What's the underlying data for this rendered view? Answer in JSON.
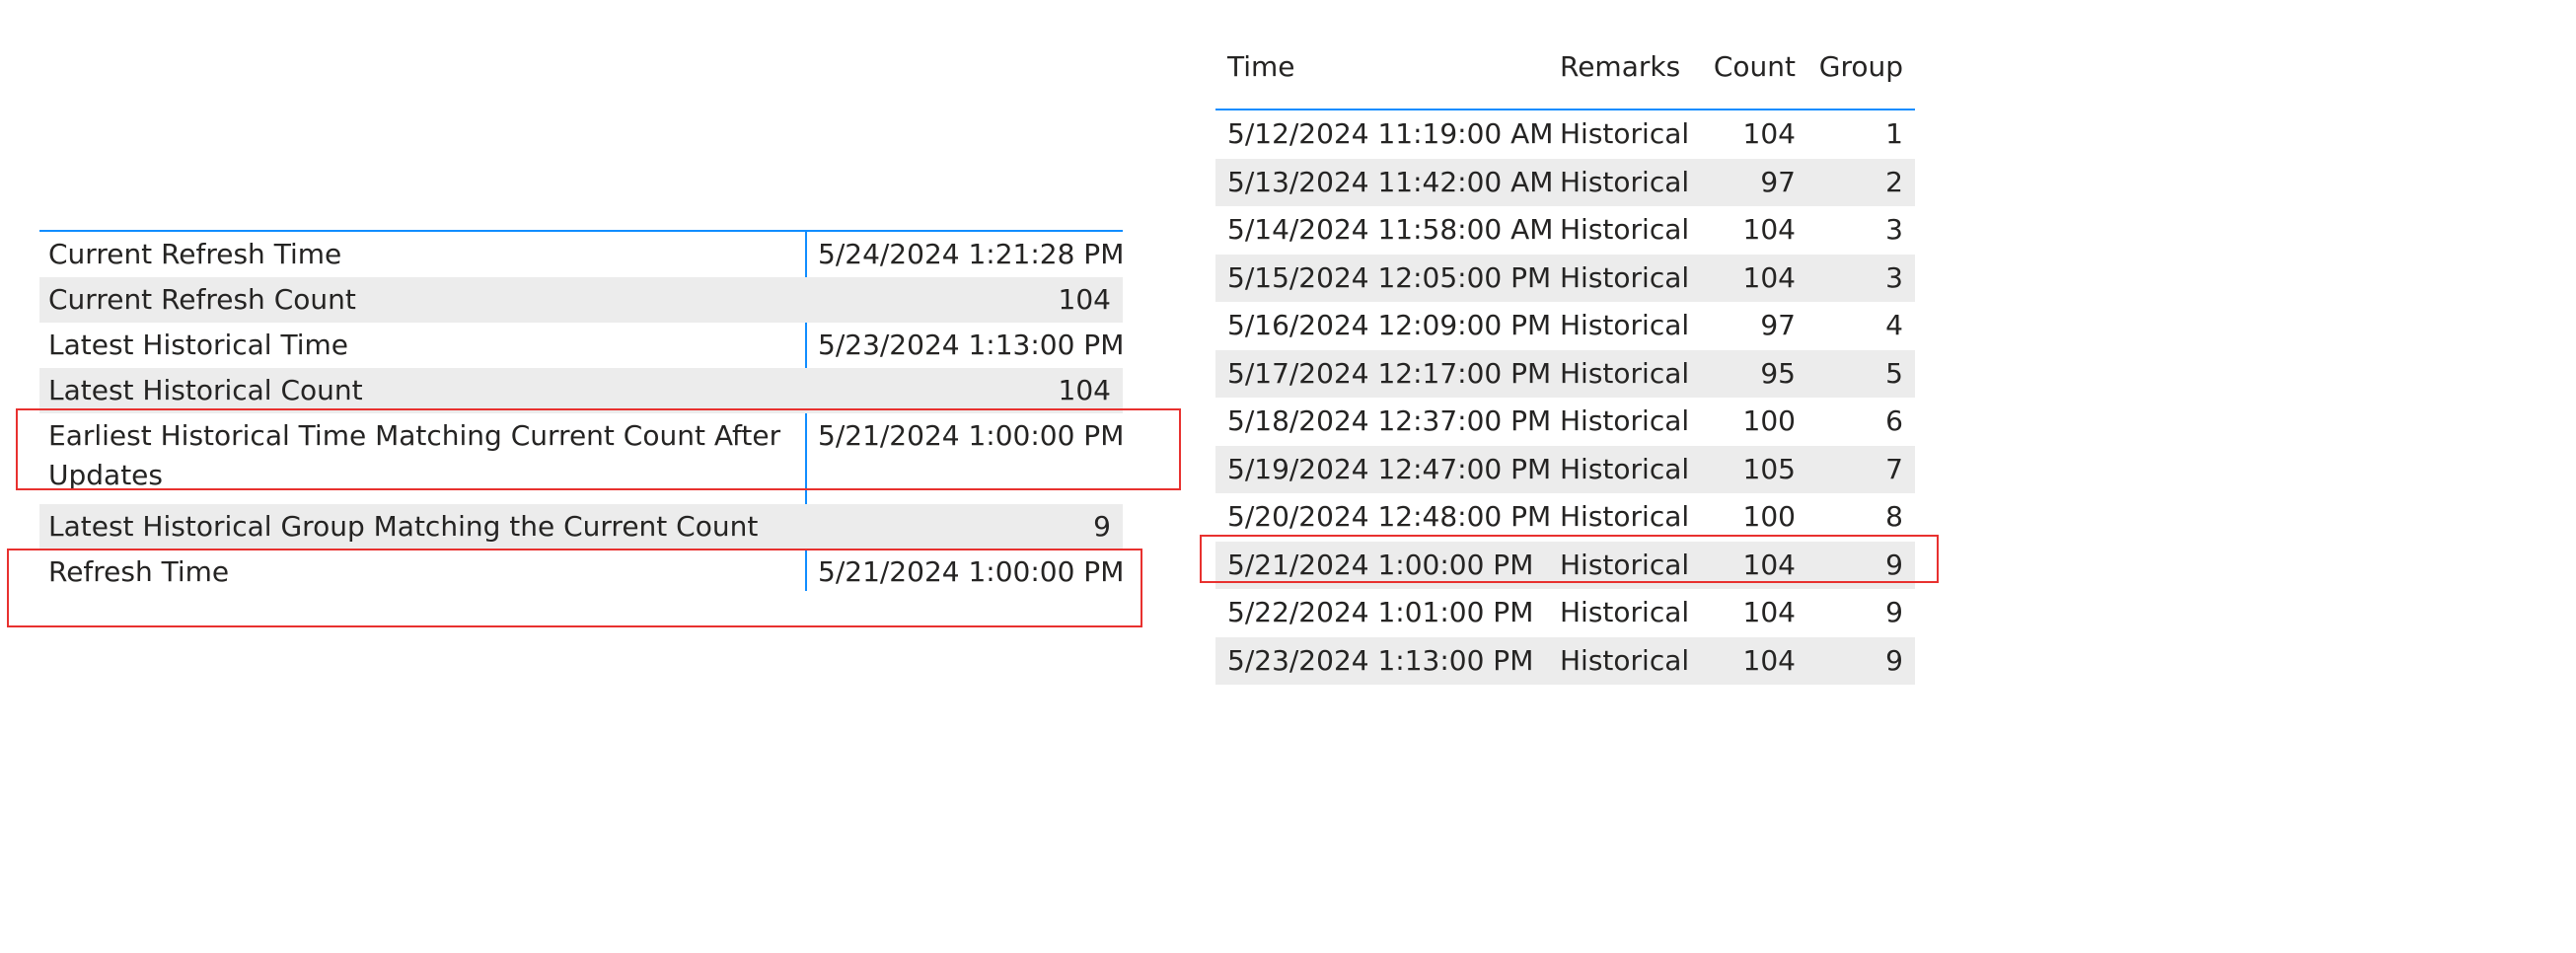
{
  "summary_table": {
    "rows": [
      {
        "label": "Current Refresh Time",
        "value": "5/24/2024 1:21:28 PM"
      },
      {
        "label": "Current Refresh Count",
        "value": "104"
      },
      {
        "label": "Latest Historical Time",
        "value": "5/23/2024 1:13:00 PM"
      },
      {
        "label": "Latest Historical Count",
        "value": "104"
      },
      {
        "label": "Earliest Historical Time Matching Current Count After Updates",
        "value": "5/21/2024 1:00:00 PM"
      },
      {
        "label": "Latest Historical Group Matching the Current Count",
        "value": "9"
      },
      {
        "label": "Refresh Time",
        "value": "5/21/2024 1:00:00 PM"
      }
    ]
  },
  "history_table": {
    "headers": {
      "time": "Time",
      "remarks": "Remarks",
      "count": "Count",
      "group": "Group"
    },
    "rows": [
      {
        "time": "5/12/2024 11:19:00 AM",
        "remarks": "Historical",
        "count": "104",
        "group": "1"
      },
      {
        "time": "5/13/2024 11:42:00 AM",
        "remarks": "Historical",
        "count": "97",
        "group": "2"
      },
      {
        "time": "5/14/2024 11:58:00 AM",
        "remarks": "Historical",
        "count": "104",
        "group": "3"
      },
      {
        "time": "5/15/2024 12:05:00 PM",
        "remarks": "Historical",
        "count": "104",
        "group": "3"
      },
      {
        "time": "5/16/2024 12:09:00 PM",
        "remarks": "Historical",
        "count": "97",
        "group": "4"
      },
      {
        "time": "5/17/2024 12:17:00 PM",
        "remarks": "Historical",
        "count": "95",
        "group": "5"
      },
      {
        "time": "5/18/2024 12:37:00 PM",
        "remarks": "Historical",
        "count": "100",
        "group": "6"
      },
      {
        "time": "5/19/2024 12:47:00 PM",
        "remarks": "Historical",
        "count": "105",
        "group": "7"
      },
      {
        "time": "5/20/2024 12:48:00 PM",
        "remarks": "Historical",
        "count": "100",
        "group": "8"
      },
      {
        "time": "5/21/2024 1:00:00 PM",
        "remarks": "Historical",
        "count": "104",
        "group": "9"
      },
      {
        "time": "5/22/2024 1:01:00 PM",
        "remarks": "Historical",
        "count": "104",
        "group": "9"
      },
      {
        "time": "5/23/2024 1:13:00 PM",
        "remarks": "Historical",
        "count": "104",
        "group": "9"
      }
    ]
  },
  "colors": {
    "accent_line": "#118dff",
    "highlight_box": "#e8312f",
    "row_shade": "#ececec"
  }
}
